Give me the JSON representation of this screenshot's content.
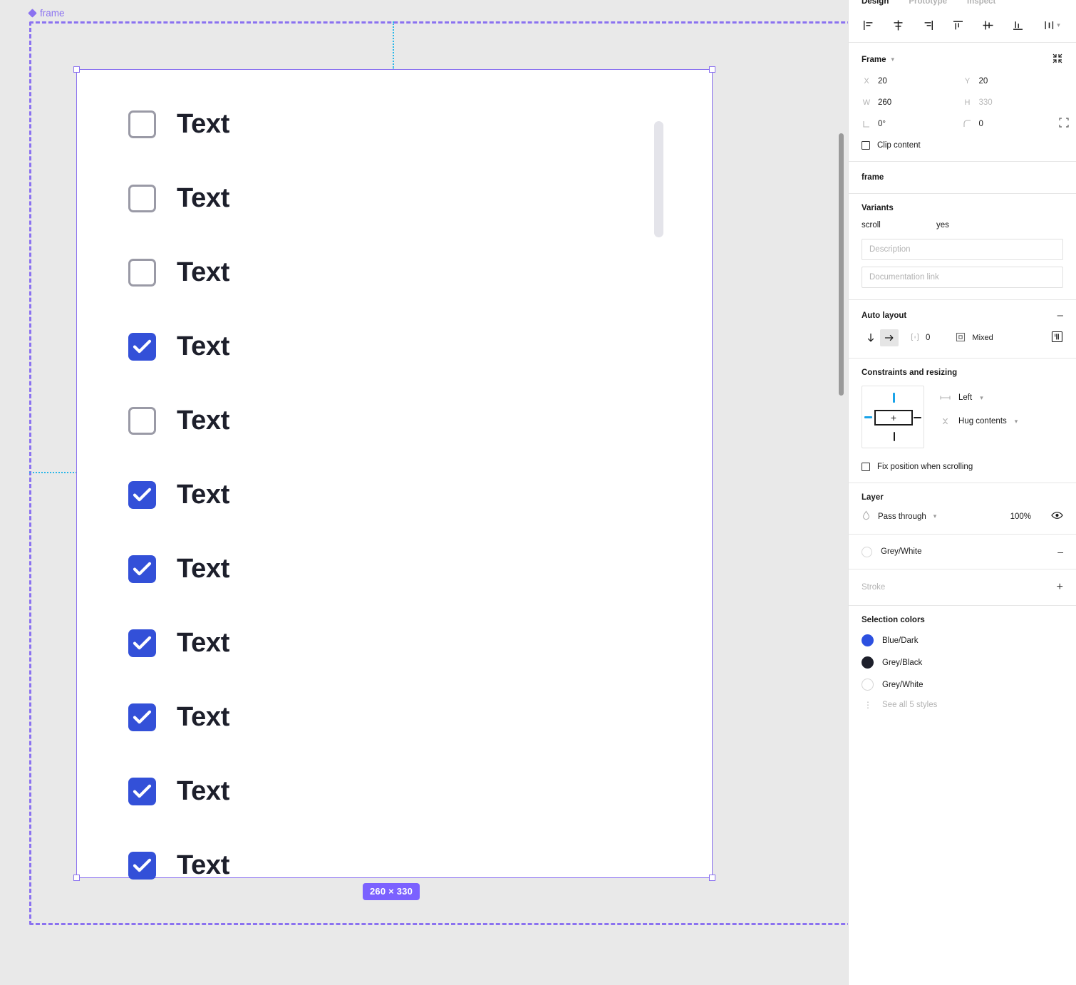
{
  "canvas": {
    "component_label": "frame",
    "size_badge": "260 × 330",
    "checkbox_label": "Text",
    "checkboxes": [
      {
        "checked": false,
        "label": "Text"
      },
      {
        "checked": false,
        "label": "Text"
      },
      {
        "checked": false,
        "label": "Text"
      },
      {
        "checked": true,
        "label": "Text"
      },
      {
        "checked": false,
        "label": "Text"
      },
      {
        "checked": true,
        "label": "Text"
      },
      {
        "checked": true,
        "label": "Text"
      },
      {
        "checked": true,
        "label": "Text"
      },
      {
        "checked": true,
        "label": "Text"
      },
      {
        "checked": true,
        "label": "Text"
      },
      {
        "checked": true,
        "label": "Text"
      }
    ],
    "colors": {
      "checkbox_blue": "#3350d8",
      "checkbox_border": "#9a9aa6",
      "label_text": "#1d1f2b",
      "component_purple": "#8b72f0",
      "badge_purple": "#7b61ff",
      "guide_cyan": "#29b6e8",
      "background": "#e9e9e9"
    }
  },
  "panel": {
    "tabs": [
      {
        "label": "Design",
        "active": true
      },
      {
        "label": "Prototype",
        "active": false
      },
      {
        "label": "Inspect",
        "active": false
      }
    ],
    "align_icons": [
      "align-left-icon",
      "align-horizontal-center-icon",
      "align-right-icon",
      "align-top-icon",
      "align-vertical-center-icon",
      "align-bottom-icon",
      "distribute-icon"
    ],
    "frame": {
      "title": "Frame",
      "x_label": "X",
      "x_value": "20",
      "y_label": "Y",
      "y_value": "20",
      "w_label": "W",
      "w_value": "260",
      "h_label": "H",
      "h_value": "330",
      "rotation_value": "0°",
      "corner_radius_value": "0",
      "clip_content_label": "Clip content"
    },
    "frame_name": "frame",
    "variants": {
      "title": "Variants",
      "rows": [
        {
          "key": "scroll",
          "value": "yes"
        }
      ],
      "description_placeholder": "Description",
      "documentation_placeholder": "Documentation link"
    },
    "auto_layout": {
      "title": "Auto layout",
      "direction": "horizontal",
      "gap_value": "0",
      "padding_value": "Mixed"
    },
    "constraints": {
      "title": "Constraints and resizing",
      "horizontal": "Left",
      "vertical": "Hug contents",
      "fix_position_label": "Fix position when scrolling"
    },
    "layer": {
      "title": "Layer",
      "blend_mode": "Pass through",
      "opacity": "100%"
    },
    "fill": {
      "name": "Grey/White"
    },
    "stroke": {
      "title": "Stroke"
    },
    "selection_colors": {
      "title": "Selection colors",
      "items": [
        {
          "name": "Blue/Dark",
          "color": "#2c50e0",
          "kind": "blue"
        },
        {
          "name": "Grey/Black",
          "color": "#1d1f2b",
          "kind": "black"
        },
        {
          "name": "Grey/White",
          "color": "#ffffff",
          "kind": "white"
        }
      ],
      "see_all": "See all 5 styles"
    }
  }
}
